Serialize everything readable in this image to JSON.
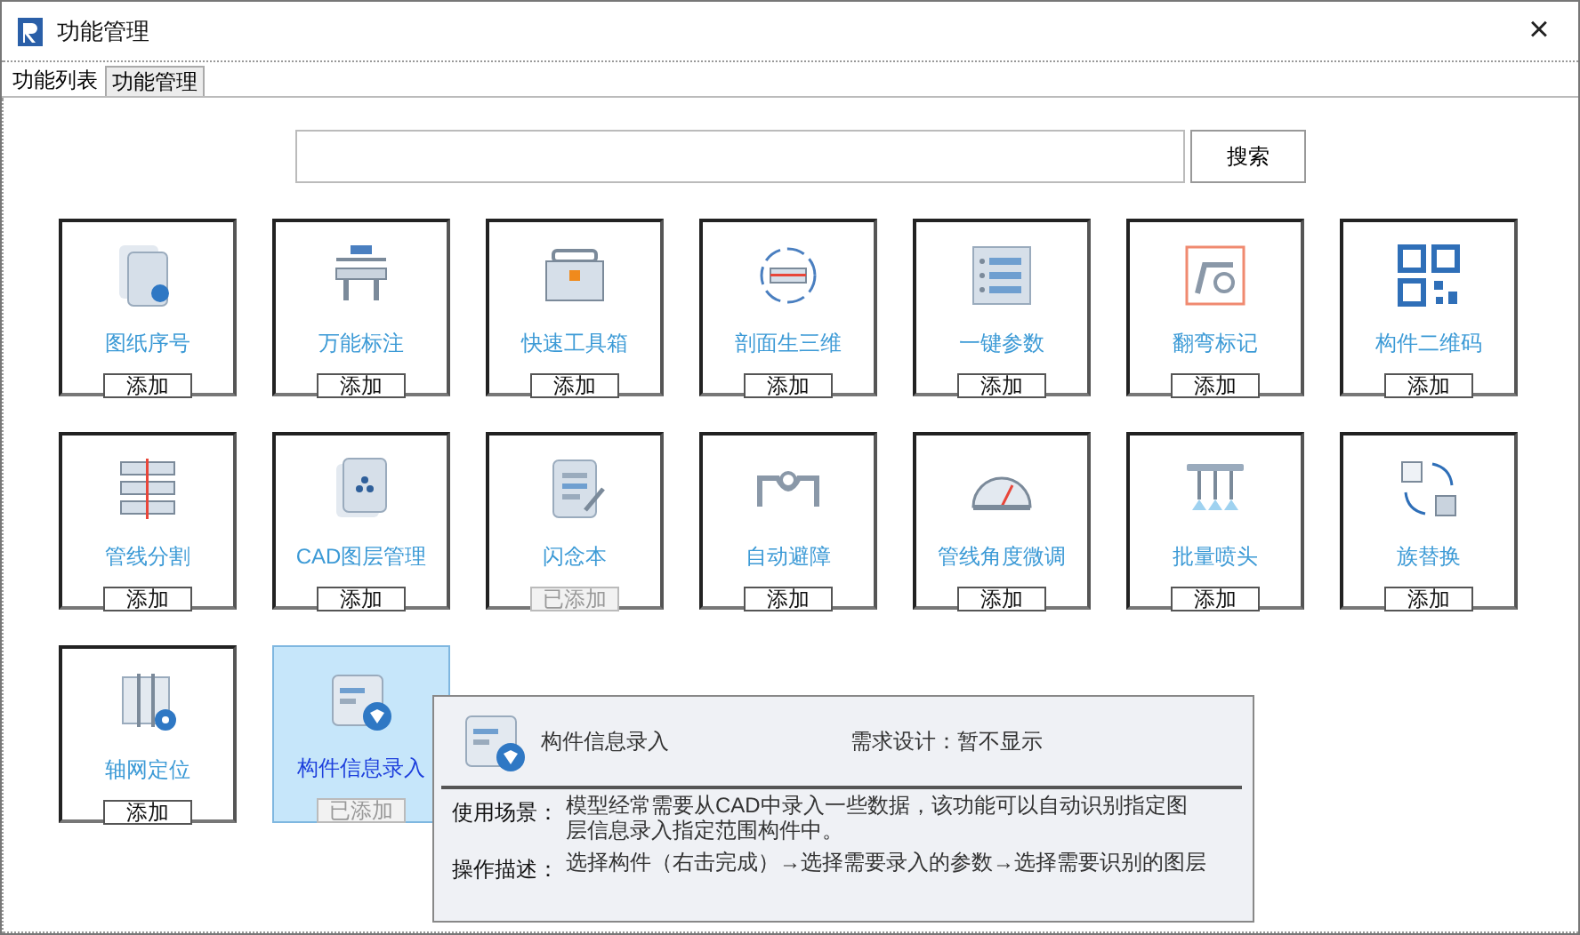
{
  "window": {
    "title": "功能管理",
    "close": "×"
  },
  "tabs": [
    {
      "label": "功能列表",
      "selected": true
    },
    {
      "label": "功能管理",
      "selected": false
    }
  ],
  "search": {
    "button": "搜索"
  },
  "cards": [
    {
      "name": "图纸序号",
      "button": "添加",
      "added": false,
      "selected": false
    },
    {
      "name": "万能标注",
      "button": "添加",
      "added": false,
      "selected": false
    },
    {
      "name": "快速工具箱",
      "button": "添加",
      "added": false,
      "selected": false
    },
    {
      "name": "剖面生三维",
      "button": "添加",
      "added": false,
      "selected": false
    },
    {
      "name": "一键参数",
      "button": "添加",
      "added": false,
      "selected": false
    },
    {
      "name": "翻弯标记",
      "button": "添加",
      "added": false,
      "selected": false
    },
    {
      "name": "构件二维码",
      "button": "添加",
      "added": false,
      "selected": false
    },
    {
      "name": "管线分割",
      "button": "添加",
      "added": false,
      "selected": false
    },
    {
      "name": "CAD图层管理",
      "button": "添加",
      "added": false,
      "selected": false
    },
    {
      "name": "闪念本",
      "button": "已添加",
      "added": true,
      "selected": false
    },
    {
      "name": "自动避障",
      "button": "添加",
      "added": false,
      "selected": false
    },
    {
      "name": "管线角度微调",
      "button": "添加",
      "added": false,
      "selected": false
    },
    {
      "name": "批量喷头",
      "button": "添加",
      "added": false,
      "selected": false
    },
    {
      "name": "族替换",
      "button": "添加",
      "added": false,
      "selected": false
    },
    {
      "name": "轴网定位",
      "button": "添加",
      "added": false,
      "selected": false
    },
    {
      "name": "构件信息录入",
      "button": "已添加",
      "added": true,
      "selected": true
    }
  ],
  "tooltip": {
    "title": "构件信息录入",
    "note": "需求设计：暂不显示",
    "rows": [
      {
        "label": "使用场景：",
        "text": "模型经常需要从CAD中录入一些数据，该功能可以自动识别指定图层信息录入指定范围构件中。"
      },
      {
        "label": "操作描述：",
        "text": "选择构件（右击完成）→选择需要录入的参数→选择需要识别的图层"
      }
    ]
  }
}
